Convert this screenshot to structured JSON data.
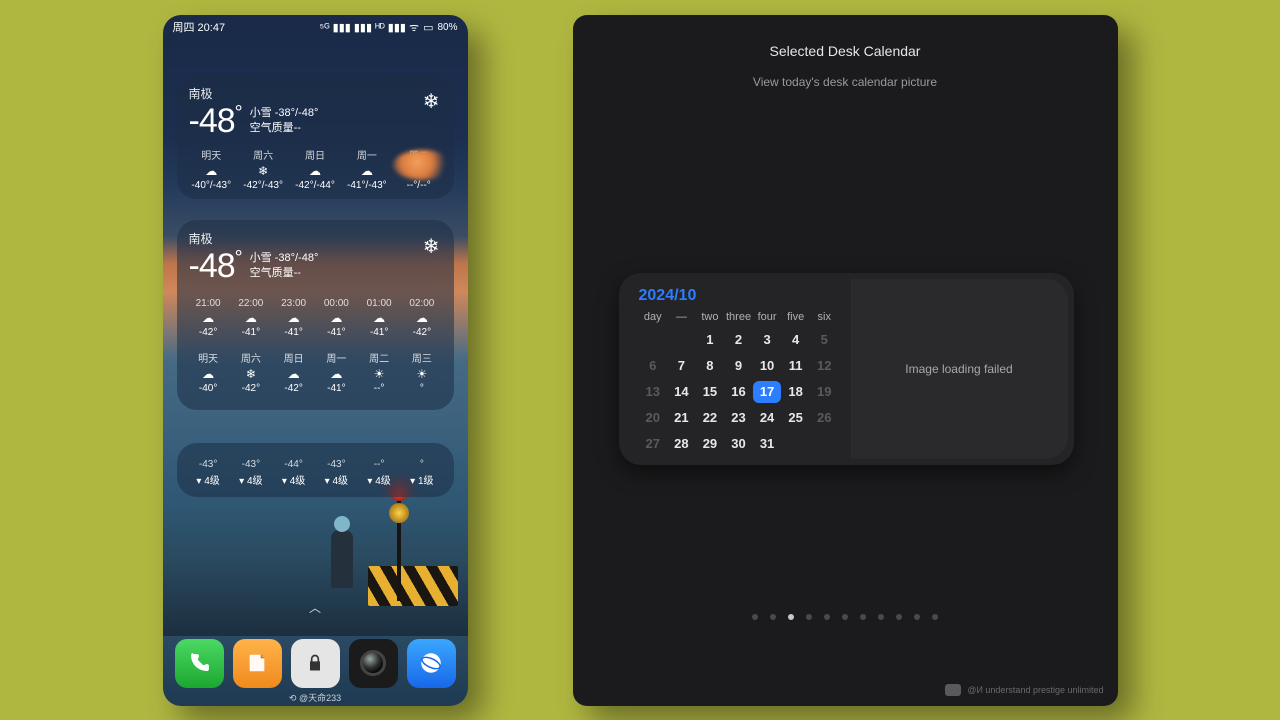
{
  "statusbar": {
    "time": "周四 20:47",
    "battery": "80%",
    "icons": "⁵ᴳ ▮▮▮ ▮▮▮ ᴴᴰ ▮▮▮ ᯤ"
  },
  "weather": {
    "location": "南极",
    "temp": "-48",
    "deg": "°",
    "cond_line1": "小雪  -38°/-48°",
    "cond_line2": "空气质量--",
    "snow_icon": "❄"
  },
  "daily": [
    {
      "lbl": "明天",
      "ic": "☁",
      "val": "-40°/-43°"
    },
    {
      "lbl": "周六",
      "ic": "❄",
      "val": "-42°/-43°"
    },
    {
      "lbl": "周日",
      "ic": "☁",
      "val": "-42°/-44°"
    },
    {
      "lbl": "周一",
      "ic": "☁",
      "val": "-41°/-43°"
    },
    {
      "lbl": "周二",
      "ic": "☀",
      "val": "--°/--°"
    }
  ],
  "hourly": [
    {
      "lbl": "21:00",
      "ic": "☁",
      "val": "-42°"
    },
    {
      "lbl": "22:00",
      "ic": "☁",
      "val": "-41°"
    },
    {
      "lbl": "23:00",
      "ic": "☁",
      "val": "-41°"
    },
    {
      "lbl": "00:00",
      "ic": "☁",
      "val": "-41°"
    },
    {
      "lbl": "01:00",
      "ic": "☁",
      "val": "-41°"
    },
    {
      "lbl": "02:00",
      "ic": "☁",
      "val": "-42°"
    }
  ],
  "daily2": [
    {
      "lbl": "明天",
      "ic": "☁",
      "val": "-40°"
    },
    {
      "lbl": "周六",
      "ic": "❄",
      "val": "-42°"
    },
    {
      "lbl": "周日",
      "ic": "☁",
      "val": "-42°"
    },
    {
      "lbl": "周一",
      "ic": "☁",
      "val": "-41°"
    },
    {
      "lbl": "周二",
      "ic": "☀",
      "val": "--°"
    },
    {
      "lbl": "周三",
      "ic": "☀",
      "val": "°"
    }
  ],
  "wind": [
    {
      "t": "-43°",
      "w": "▾ 4级"
    },
    {
      "t": "-43°",
      "w": "▾ 4级"
    },
    {
      "t": "-44°",
      "w": "▾ 4级"
    },
    {
      "t": "-43°",
      "w": "▾ 4级"
    },
    {
      "t": "--°",
      "w": "▾ 4级"
    },
    {
      "t": "°",
      "w": "▾ 1级"
    }
  ],
  "credit": "⟲ @天命233",
  "panel": {
    "title": "Selected Desk Calendar",
    "subtitle": "View today's desk calendar picture",
    "fail": "Image loading failed",
    "month": "2024/10",
    "dow": [
      "day",
      "—",
      "two",
      "three",
      "four",
      "five",
      "six"
    ],
    "watermark": "@И understand prestige unlimited"
  },
  "cal": [
    {
      "n": "",
      "dim": true
    },
    {
      "n": "",
      "dim": true
    },
    {
      "n": "1"
    },
    {
      "n": "2"
    },
    {
      "n": "3"
    },
    {
      "n": "4"
    },
    {
      "n": "5",
      "dim": true
    },
    {
      "n": "6",
      "dim": true
    },
    {
      "n": "7"
    },
    {
      "n": "8"
    },
    {
      "n": "9"
    },
    {
      "n": "10"
    },
    {
      "n": "11"
    },
    {
      "n": "12",
      "dim": true
    },
    {
      "n": "13",
      "dim": true
    },
    {
      "n": "14"
    },
    {
      "n": "15"
    },
    {
      "n": "16"
    },
    {
      "n": "17",
      "sel": true
    },
    {
      "n": "18"
    },
    {
      "n": "19",
      "dim": true
    },
    {
      "n": "20",
      "dim": true
    },
    {
      "n": "21"
    },
    {
      "n": "22"
    },
    {
      "n": "23"
    },
    {
      "n": "24"
    },
    {
      "n": "25"
    },
    {
      "n": "26",
      "dim": true
    },
    {
      "n": "27",
      "dim": true
    },
    {
      "n": "28"
    },
    {
      "n": "29"
    },
    {
      "n": "30"
    },
    {
      "n": "31"
    },
    {
      "n": ""
    },
    {
      "n": ""
    }
  ],
  "dots": {
    "count": 11,
    "active": 2
  }
}
